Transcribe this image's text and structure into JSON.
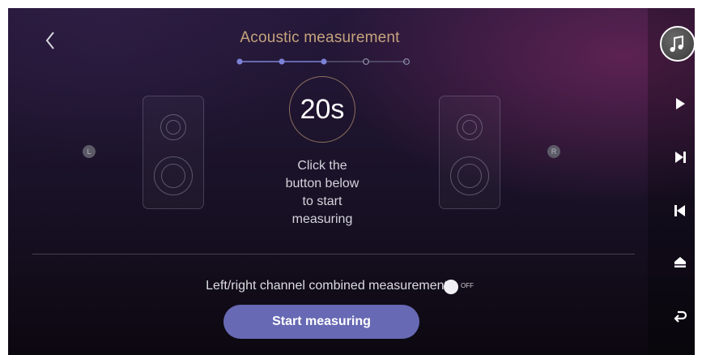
{
  "header": {
    "title": "Acoustic measurement",
    "steps": {
      "total": 5,
      "completed": 3
    }
  },
  "speakers": {
    "left_label": "L",
    "right_label": "R"
  },
  "measurement": {
    "countdown": "20s",
    "instruction_lines": [
      "Click the",
      "button below",
      "to start",
      "measuring"
    ]
  },
  "options": {
    "combined_label": "Left/right channel combined measurement",
    "toggle_state": "OFF"
  },
  "actions": {
    "start_label": "Start measuring"
  },
  "side_controls": [
    "music-note-icon",
    "play-icon",
    "next-track-icon",
    "previous-track-icon",
    "home-icon",
    "return-icon"
  ],
  "colors": {
    "title": "#c6a37c",
    "button": "#6769b4",
    "step_active": "#7b82d6",
    "timer_ring": "#c4a078"
  }
}
